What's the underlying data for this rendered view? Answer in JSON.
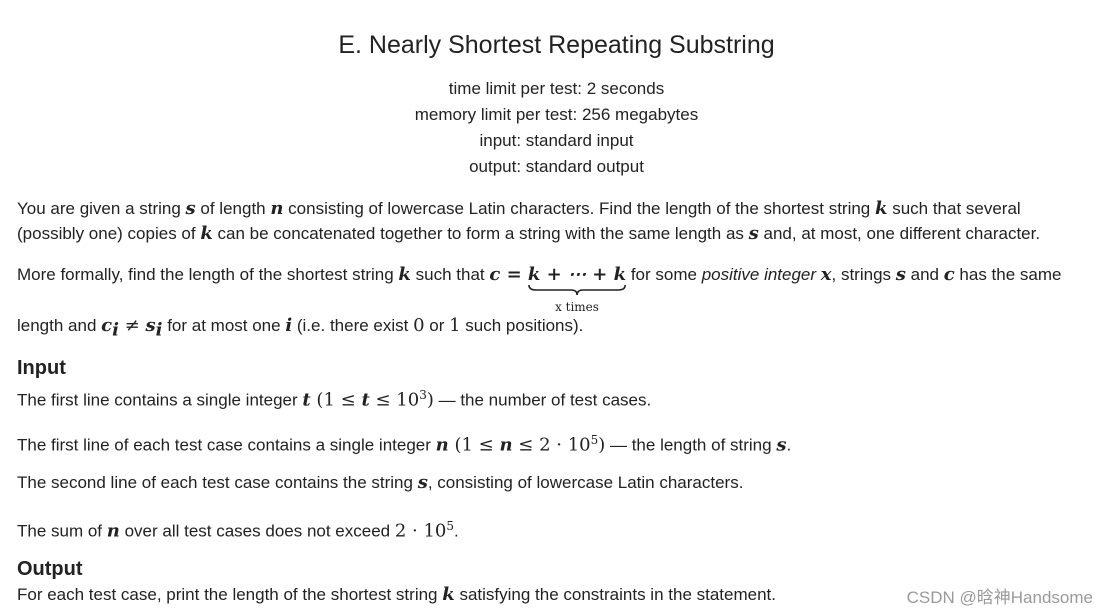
{
  "problem": {
    "title": "E. Nearly Shortest Repeating Substring",
    "time_limit": "time limit per test: 2 seconds",
    "memory_limit": "memory limit per test: 256 megabytes",
    "input_file": "input: standard input",
    "output_file": "output: standard output"
  },
  "statement": {
    "p1": {
      "t1": "You are given a string ",
      "v1": "s",
      "t2": " of length ",
      "v2": "n",
      "t3": " consisting of lowercase Latin characters. Find the length of the shortest string ",
      "v3": "k",
      "t4": " such that several",
      "t5": "(possibly one) copies of ",
      "v4": "k",
      "t6": " can be concatenated together to form a string with the same length as ",
      "v5": "s",
      "t7": " and, at most, one different character."
    },
    "p2": {
      "t1": "More formally, find the length of the shortest string ",
      "v1": "k",
      "t2": " such that ",
      "formula_lhs": "c = ",
      "formula_sum": "k + ⋯ + k",
      "brace_label": "x times",
      "t3": " for some ",
      "emph": "positive integer",
      "v2": "x",
      "t4": ", strings ",
      "v3": "s",
      "t5": " and ",
      "v4": "c",
      "t6": " has the same",
      "t7": "length and ",
      "c": "c",
      "i1": "i",
      "neq": " ≠ ",
      "s": "s",
      "i2": "i",
      "t8": " for at most one ",
      "v5": "i",
      "t9": " (i.e. there exist ",
      "n0": "0",
      "t10": " or ",
      "n1": "1",
      "t11": " such positions)."
    }
  },
  "input_section": {
    "heading": "Input",
    "l1": {
      "t1": "The first line contains a single integer ",
      "v": "t",
      "open": " (1 ≤ ",
      "v2": "t",
      "le": " ≤ 10",
      "exp": "3",
      "close": ")",
      "t2": " — the number of test cases."
    },
    "l2": {
      "t1": "The first line of each test case contains a single integer ",
      "v": "n",
      "open": " (1 ≤ ",
      "v2": "n",
      "le": " ≤ 2 · 10",
      "exp": "5",
      "close": ")",
      "t2": " — the length of string ",
      "v3": "s",
      "t3": "."
    },
    "l3": {
      "t1": "The second line of each test case contains the string ",
      "v": "s",
      "t2": ", consisting of lowercase Latin characters."
    },
    "l4": {
      "t1": "The sum of ",
      "v": "n",
      "t2": " over all test cases does not exceed ",
      "num": "2 · 10",
      "exp": "5",
      "t3": "."
    }
  },
  "output_section": {
    "heading": "Output",
    "l1": {
      "t1": "For each test case, print the length of the shortest string ",
      "v": "k",
      "t2": " satisfying the constraints in the statement."
    }
  },
  "watermark": "CSDN @晗神Handsome"
}
